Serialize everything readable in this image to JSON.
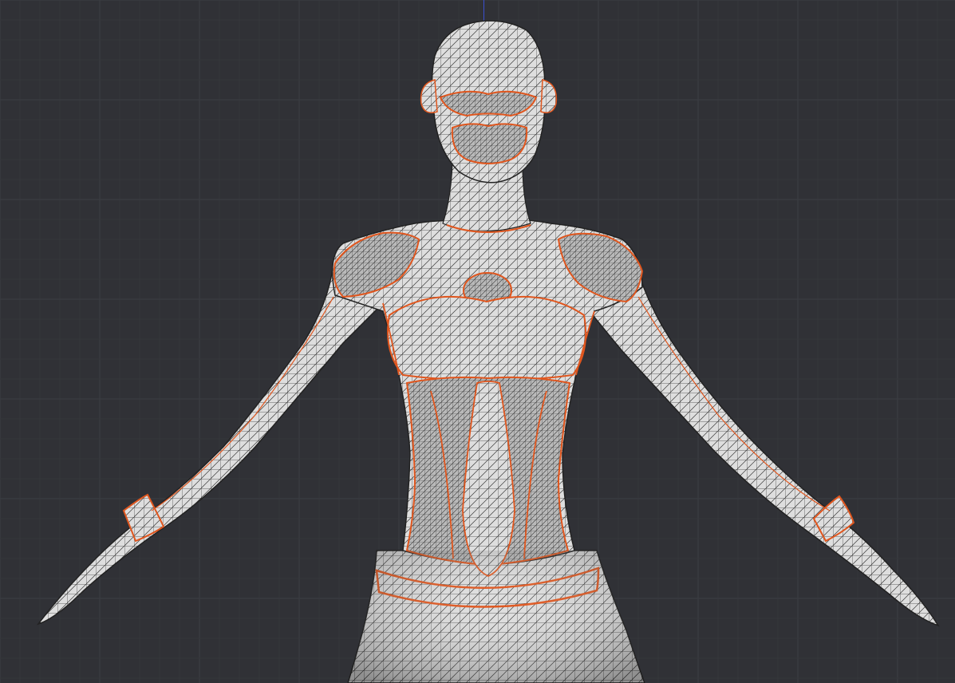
{
  "viewport": {
    "background_color": "#303136",
    "grid_minor_color": "#35363b",
    "grid_major_color": "#3b3c42",
    "axis_z_color": "#3a4fd0"
  },
  "model": {
    "mesh_fill_color": "#dedede",
    "wire_color": "#3a3a3a",
    "seam_color": "#e0561e"
  }
}
